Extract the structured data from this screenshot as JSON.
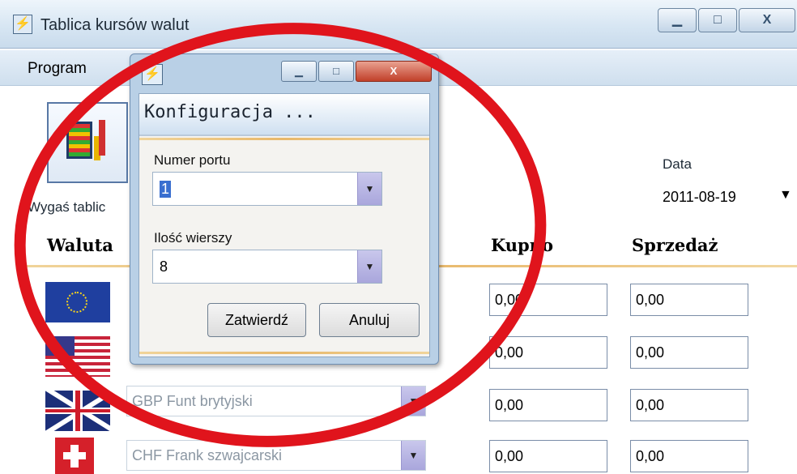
{
  "main_window": {
    "title": "Tablica kursów walut",
    "controls": {
      "minimize": "▁",
      "maximize": "□",
      "close": "X"
    }
  },
  "menu": {
    "program": "Program"
  },
  "toolbar": {
    "expire_table_label": "Wygaś tablic"
  },
  "date": {
    "label": "Data",
    "value": "2011-08-19",
    "arrow": "▼"
  },
  "table": {
    "headers": {
      "currency": "Waluta",
      "buy": "Kupno",
      "sell": "Sprzedaż"
    },
    "rows": [
      {
        "currency": "",
        "buy": "0,00",
        "sell": "0,00"
      },
      {
        "currency": "",
        "buy": "0,00",
        "sell": "0,00"
      },
      {
        "currency": "GBP Funt brytyjski",
        "buy": "0,00",
        "sell": "0,00"
      },
      {
        "currency": "CHF Frank szwajcarski",
        "buy": "0,00",
        "sell": "0,00"
      }
    ]
  },
  "dialog": {
    "title": "Konfiguracja ...",
    "controls": {
      "minimize": "▁",
      "maximize": "□",
      "close": "X"
    },
    "port_label": "Numer portu",
    "port_value": "1",
    "rows_label": "Ilość wierszy",
    "rows_value": "8",
    "ok_button": "Zatwierdź",
    "cancel_button": "Anuluj"
  },
  "colors": {
    "annotation": "#e0141c",
    "accent_separator": "#e8b86a",
    "combo_button": "#b5b2e2"
  }
}
